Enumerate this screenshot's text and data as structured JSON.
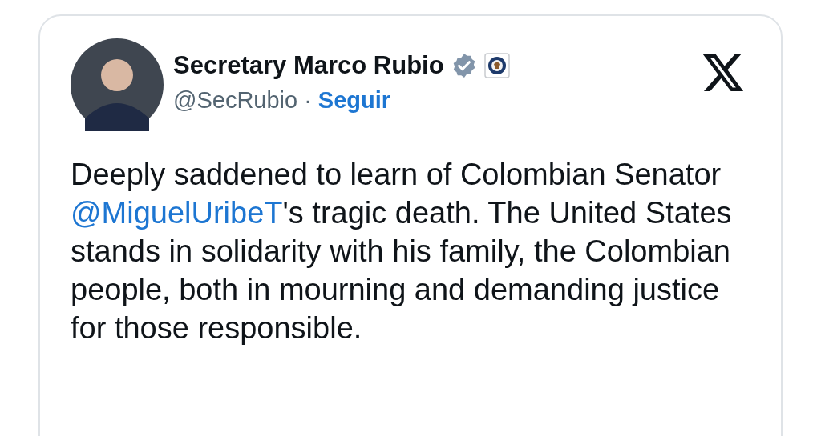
{
  "author": {
    "name": "Secretary Marco Rubio",
    "verified": true,
    "handle": "@SecRubio",
    "separator": "·",
    "follow": "Seguir"
  },
  "post": {
    "before": "Deeply saddened to learn of Colombian Senator ",
    "mention": "@MiguelUribeT",
    "after": "'s tragic death. The United States stands in solidarity with his family, the Colombian people, both in mourning and demanding justice for those responsible."
  }
}
